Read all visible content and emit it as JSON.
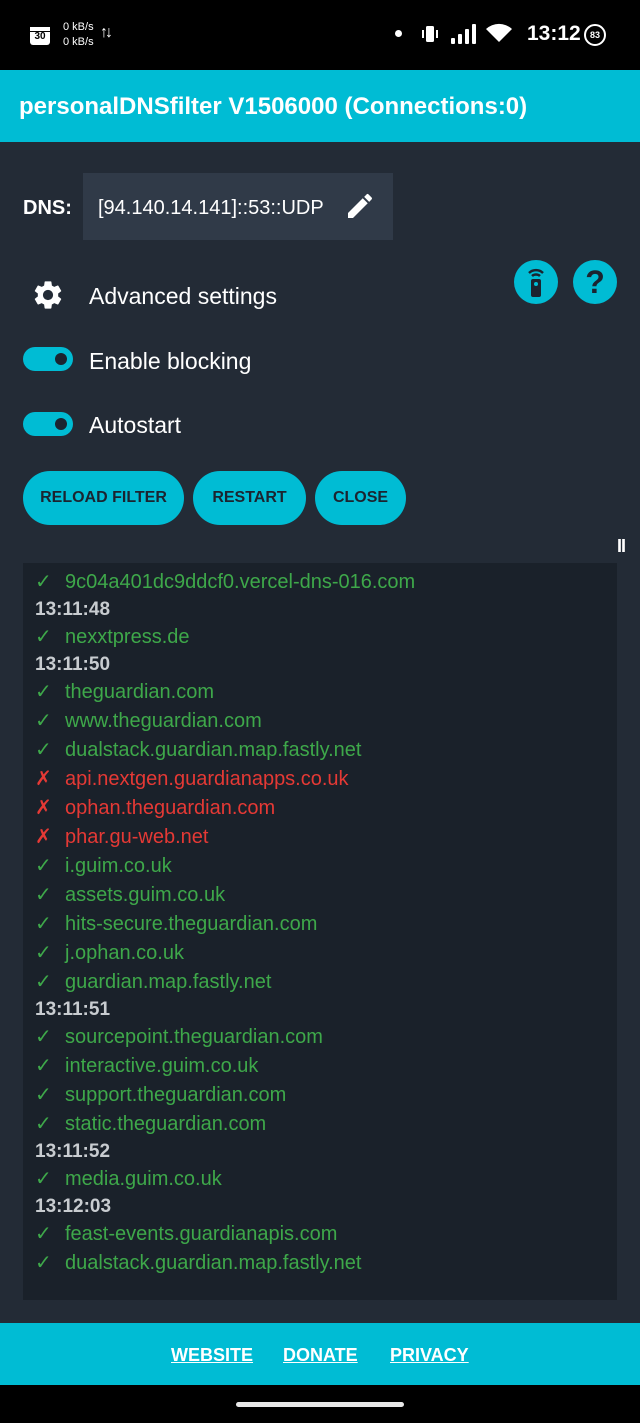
{
  "status_bar": {
    "calendar_day": "30",
    "net_up": "0 kB/s",
    "net_down": "0 kB/s",
    "time": "13:12",
    "battery": "83",
    "icons": [
      "calendar-icon",
      "data-arrows-icon",
      "dot-icon",
      "vibrate-icon",
      "signal-icon",
      "wifi-icon",
      "battery-icon"
    ]
  },
  "app_bar": {
    "title": "personalDNSfilter V1506000 (Connections:0)"
  },
  "dns": {
    "label": "DNS:",
    "value": "[94.140.14.141]::53::UDP"
  },
  "settings": {
    "advanced_label": "Advanced settings",
    "enable_blocking_label": "Enable blocking",
    "enable_blocking_on": true,
    "autostart_label": "Autostart",
    "autostart_on": true
  },
  "buttons": {
    "reload": "RELOAD FILTER",
    "restart": "RESTART",
    "close": "CLOSE"
  },
  "pause_label": "II",
  "log": [
    {
      "kind": "ok",
      "text": "9c04a401dc9ddcf0.vercel-dns-016.com"
    },
    {
      "kind": "time",
      "text": "13:11:48"
    },
    {
      "kind": "ok",
      "text": "nexxtpress.de"
    },
    {
      "kind": "time",
      "text": "13:11:50"
    },
    {
      "kind": "ok",
      "text": "theguardian.com"
    },
    {
      "kind": "ok",
      "text": "www.theguardian.com"
    },
    {
      "kind": "ok",
      "text": "dualstack.guardian.map.fastly.net"
    },
    {
      "kind": "block",
      "text": "api.nextgen.guardianapps.co.uk"
    },
    {
      "kind": "block",
      "text": "ophan.theguardian.com"
    },
    {
      "kind": "block",
      "text": "phar.gu-web.net"
    },
    {
      "kind": "ok",
      "text": "i.guim.co.uk"
    },
    {
      "kind": "ok",
      "text": "assets.guim.co.uk"
    },
    {
      "kind": "ok",
      "text": "hits-secure.theguardian.com"
    },
    {
      "kind": "ok",
      "text": "j.ophan.co.uk"
    },
    {
      "kind": "ok",
      "text": "guardian.map.fastly.net"
    },
    {
      "kind": "time",
      "text": "13:11:51"
    },
    {
      "kind": "ok",
      "text": "sourcepoint.theguardian.com"
    },
    {
      "kind": "ok",
      "text": "interactive.guim.co.uk"
    },
    {
      "kind": "ok",
      "text": "support.theguardian.com"
    },
    {
      "kind": "ok",
      "text": "static.theguardian.com"
    },
    {
      "kind": "time",
      "text": "13:11:52"
    },
    {
      "kind": "ok",
      "text": "media.guim.co.uk"
    },
    {
      "kind": "time",
      "text": "13:12:03"
    },
    {
      "kind": "ok",
      "text": "feast-events.guardianapis.com"
    },
    {
      "kind": "ok",
      "text": "dualstack.guardian.map.fastly.net"
    }
  ],
  "marks": {
    "ok": "✓",
    "block": "✗"
  },
  "footer": {
    "website": "WEBSITE",
    "donate": "DONATE",
    "privacy": "PRIVACY"
  },
  "colors": {
    "accent": "#00bcd4",
    "background": "#232b36",
    "log_bg": "#1a212a",
    "ok": "#3ea84a",
    "blocked": "#e53935"
  }
}
